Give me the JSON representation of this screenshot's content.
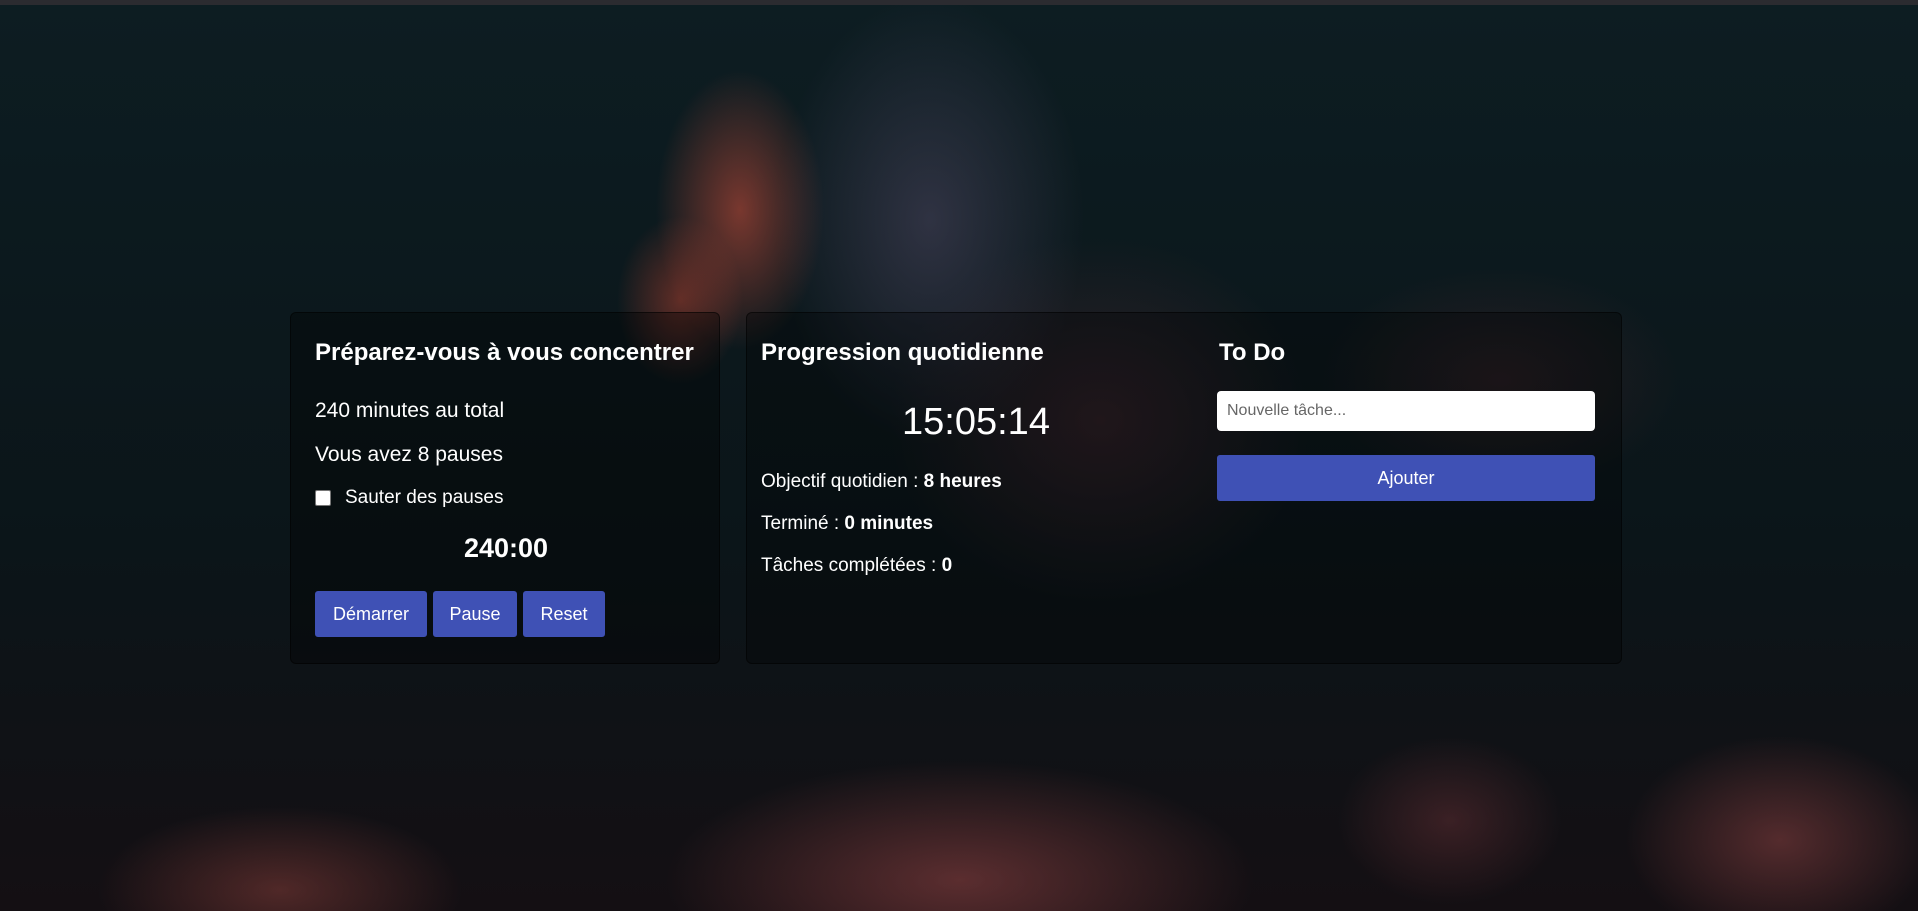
{
  "focus_card": {
    "title": "Préparez-vous à vous concentrer",
    "total_text": "240 minutes au total",
    "pauses_text": "Vous avez 8 pauses",
    "skip_label": "Sauter des pauses",
    "skip_checked": false,
    "timer": "240:00",
    "buttons": {
      "start": "Démarrer",
      "pause": "Pause",
      "reset": "Reset"
    }
  },
  "progress_card": {
    "title": "Progression quotidienne",
    "clock": "15:05:14",
    "goal_label": "Objectif quotidien : ",
    "goal_value": "8 heures",
    "done_label": "Terminé : ",
    "done_value": "0 minutes",
    "tasks_label": "Tâches complétées : ",
    "tasks_value": "0"
  },
  "todo": {
    "title": "To Do",
    "placeholder": "Nouvelle tâche...",
    "add_label": "Ajouter"
  },
  "colors": {
    "accent": "#3f51b5",
    "text": "#ffffff"
  }
}
